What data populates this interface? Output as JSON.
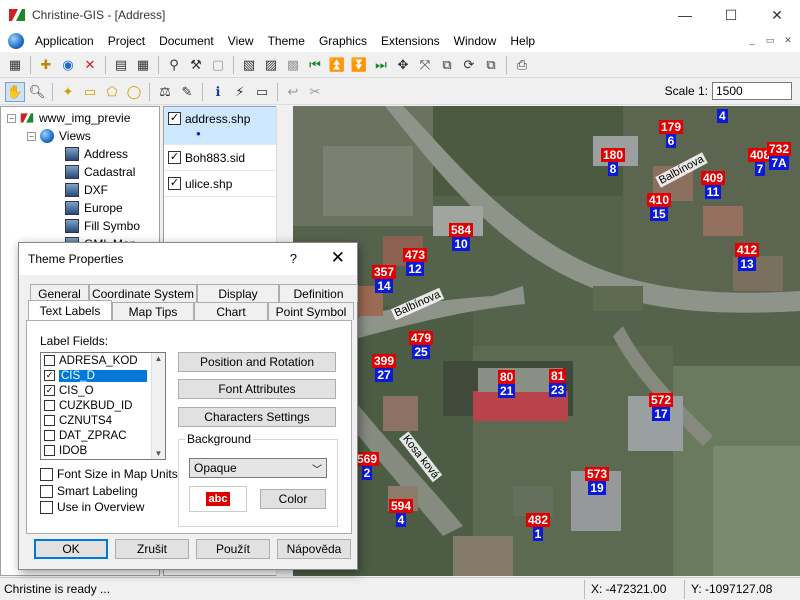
{
  "window": {
    "title": "Christine-GIS - [Address]",
    "controls": [
      "—",
      "☐",
      "✕"
    ]
  },
  "menu": [
    "Application",
    "Project",
    "Document",
    "View",
    "Theme",
    "Graphics",
    "Extensions",
    "Window",
    "Help"
  ],
  "mdi_controls": [
    "_",
    "▭",
    "✕"
  ],
  "toolbar": {
    "scale_label": "Scale 1:",
    "scale_value": "1500"
  },
  "tree": {
    "root": "www_img_previe",
    "views_label": "Views",
    "items": [
      "Address",
      "Cadastral",
      "DXF",
      "Europe",
      "Fill Symbo",
      "GML Map"
    ]
  },
  "layers": [
    {
      "name": "address.shp",
      "checked": true,
      "selected": true
    },
    {
      "name": "Boh883.sid",
      "checked": true,
      "selected": false
    },
    {
      "name": "ulice.shp",
      "checked": true,
      "selected": false
    }
  ],
  "map": {
    "labels": [
      {
        "num": "4",
        "red": ""
      },
      {
        "num": "6",
        "red": "179"
      },
      {
        "num": "8",
        "red": "180"
      },
      {
        "num": "7",
        "red": "408"
      },
      {
        "num": "7A",
        "red": "732"
      },
      {
        "num": "11",
        "red": "409"
      },
      {
        "num": "15",
        "red": "410"
      },
      {
        "num": "10",
        "red": "584"
      },
      {
        "num": "12",
        "red": "473"
      },
      {
        "num": "14",
        "red": "357"
      },
      {
        "num": "13",
        "red": "412"
      },
      {
        "num": "25",
        "red": "479"
      },
      {
        "num": "27",
        "red": "399"
      },
      {
        "num": "21",
        "red": "80"
      },
      {
        "num": "23",
        "red": "81"
      },
      {
        "num": "17",
        "red": "572"
      },
      {
        "num": "2",
        "red": "569"
      },
      {
        "num": "19",
        "red": "573"
      },
      {
        "num": "4",
        "red": "594"
      },
      {
        "num": "1",
        "red": "482"
      }
    ],
    "streets": [
      "Balbínova",
      "Balbínova",
      "Kosa ková"
    ]
  },
  "status": {
    "message": "Christine is ready ...",
    "x": "X: -472321.00",
    "y": "Y: -1097127.08"
  },
  "dialog": {
    "title": "Theme Properties",
    "help": "?",
    "close": "✕",
    "tabs_row1": [
      "General",
      "Coordinate System",
      "Display",
      "Definition"
    ],
    "tabs_row2": [
      "Text Labels",
      "Map Tips",
      "Chart",
      "Point Symbol"
    ],
    "label_fields_title": "Label Fields:",
    "fields": [
      {
        "name": "ADRESA_KOD",
        "checked": false,
        "selected": false
      },
      {
        "name": "CIS_D",
        "checked": true,
        "selected": true
      },
      {
        "name": "CIS_O",
        "checked": true,
        "selected": false
      },
      {
        "name": "CUZKBUD_ID",
        "checked": false,
        "selected": false
      },
      {
        "name": "CZNUTS4",
        "checked": false,
        "selected": false
      },
      {
        "name": "DAT_ZPRAC",
        "checked": false,
        "selected": false
      },
      {
        "name": "IDOB",
        "checked": false,
        "selected": false
      }
    ],
    "buttons_right": [
      "Position and Rotation",
      "Font Attributes",
      "Characters Settings"
    ],
    "background_title": "Background",
    "background_value": "Opaque",
    "preview_text": "abc",
    "color_button": "Color",
    "options": [
      "Font Size in Map Units",
      "Smart Labeling",
      "Use in Overview"
    ],
    "footer": [
      "OK",
      "Zrušit",
      "Použít",
      "Nápověda"
    ]
  },
  "colors": {
    "label_red": "#e30000",
    "label_blue": "#0a1ad8",
    "selection": "#0078d7"
  }
}
